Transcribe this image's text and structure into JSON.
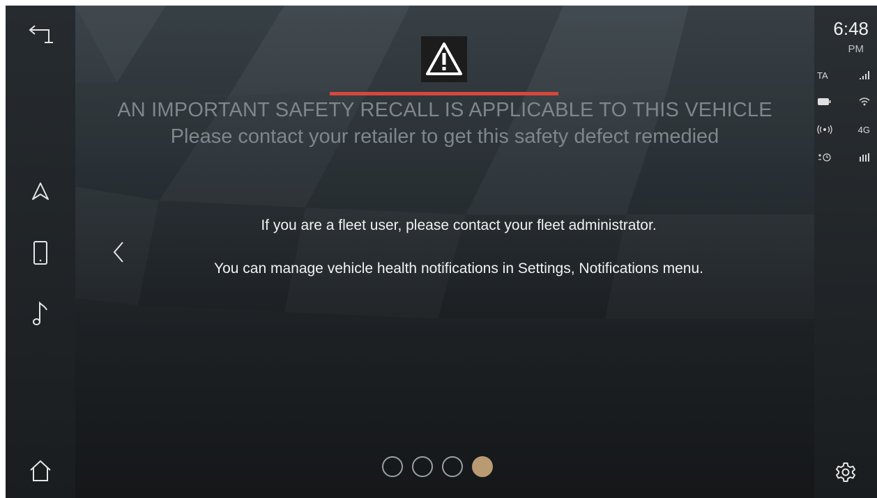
{
  "status": {
    "time": "6:48",
    "ampm": "PM",
    "ta_label": "TA",
    "network_label": "4G"
  },
  "alert": {
    "title": "AN IMPORTANT SAFETY RECALL IS APPLICABLE TO THIS VEHICLE",
    "subtitle": "Please contact your retailer to get this safety defect remedied",
    "fleet_message": "If you are a fleet user, please contact your fleet administrator.",
    "settings_message": "You can manage vehicle health notifications in Settings, Notifications menu."
  },
  "pagination": {
    "total": 4,
    "active": 4
  },
  "colors": {
    "accent_red": "#d9473b",
    "active_dot": "#b99a72"
  },
  "icons": {
    "back": "back-arrow-icon",
    "navigation": "navigation-icon",
    "phone": "phone-icon",
    "media": "music-note-icon",
    "home": "home-icon",
    "previous": "chevron-left-icon",
    "warning": "warning-triangle-icon",
    "settings": "gear-icon"
  }
}
